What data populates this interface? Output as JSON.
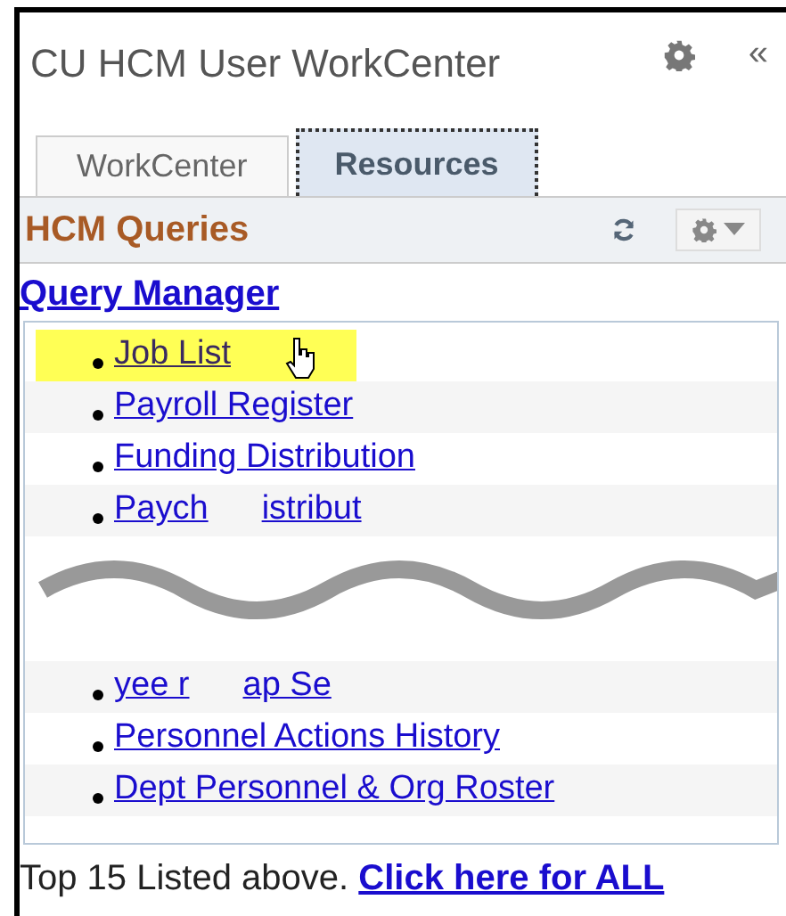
{
  "title": "CU HCM User WorkCenter",
  "collapse_glyph": "«",
  "tabs": [
    {
      "label": "WorkCenter",
      "selected": false
    },
    {
      "label": "Resources",
      "selected": true
    }
  ],
  "section": {
    "title": "HCM Queries"
  },
  "link_heading": "Query Manager",
  "queries": [
    {
      "kind": "link",
      "label": "Job List",
      "highlighted": true
    },
    {
      "kind": "link",
      "label": "Payroll Register",
      "highlighted": false
    },
    {
      "kind": "link",
      "label": "Funding Distribution",
      "highlighted": false
    },
    {
      "kind": "torn",
      "fragments": [
        "Paych",
        "istribut"
      ]
    },
    {
      "kind": "gap"
    },
    {
      "kind": "torn",
      "fragments": [
        "yee r",
        "ap Se"
      ]
    },
    {
      "kind": "link",
      "label": "Personnel Actions History",
      "highlighted": false
    },
    {
      "kind": "link",
      "label": "Dept Personnel & Org Roster",
      "highlighted": false
    }
  ],
  "footer": {
    "text": "Top 15 Listed above.",
    "link": "Click here for ALL"
  }
}
